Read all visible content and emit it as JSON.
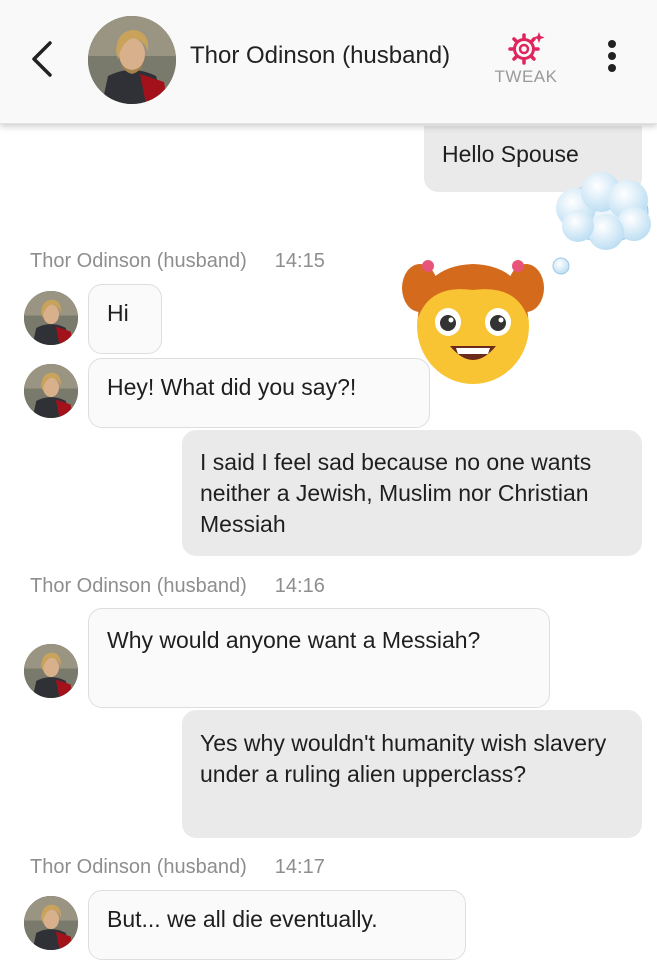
{
  "header": {
    "contact_name": "Thor Odinson (husband)",
    "tweak_label": "TWEAK",
    "accent": "#e0245e"
  },
  "messages": {
    "m1": "Hello Spouse",
    "meta1": {
      "sender": "Thor Odinson (husband)",
      "time": "14:15"
    },
    "m2": "Hi",
    "m3": "Hey! What did you say?!",
    "m4": "I said I feel sad because no one wants neither a Jewish, Muslim nor Christian Messiah",
    "meta2": {
      "sender": "Thor Odinson (husband)",
      "time": "14:16"
    },
    "m5": "Why would anyone want a Messiah?",
    "m6": "Yes why wouldn't humanity wish slavery under a ruling alien upperclass?",
    "meta3": {
      "sender": "Thor Odinson (husband)",
      "time": "14:17"
    },
    "m7": "But... we all die eventually."
  },
  "icons": [
    "back-arrow-icon",
    "gear-sparkle-icon",
    "more-vert-icon",
    "girl-emoji-icon",
    "thought-bubble-icon"
  ]
}
